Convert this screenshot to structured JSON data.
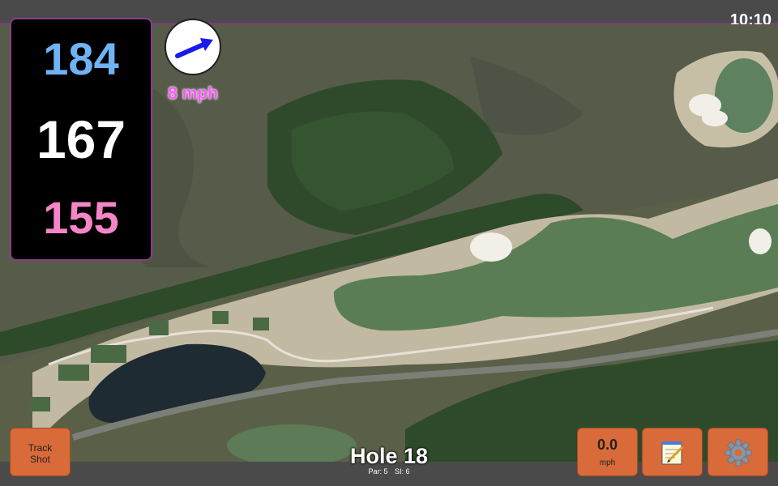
{
  "status_bar": {
    "time": "10:10"
  },
  "distances": {
    "back": "184",
    "middle": "167",
    "front": "155",
    "colors": {
      "back": "#6fb3f5",
      "middle": "#ffffff",
      "front": "#f585c8"
    }
  },
  "wind": {
    "speed_label": "8 mph",
    "arrow_icon": "wind-direction-arrow-icon",
    "arrow_color": "#1a1aee"
  },
  "hole": {
    "title": "Hole 18",
    "par": "Par: 5",
    "si": "SI: 6"
  },
  "buttons": {
    "track_shot": {
      "line1": "Track",
      "line2": "Shot"
    },
    "speed": {
      "value": "0.0",
      "unit": "mph"
    },
    "notes_icon": "notepad-icon",
    "settings_icon": "gear-icon"
  },
  "colors": {
    "button": "#d96a3a",
    "accent_border": "#8a3d8a"
  }
}
